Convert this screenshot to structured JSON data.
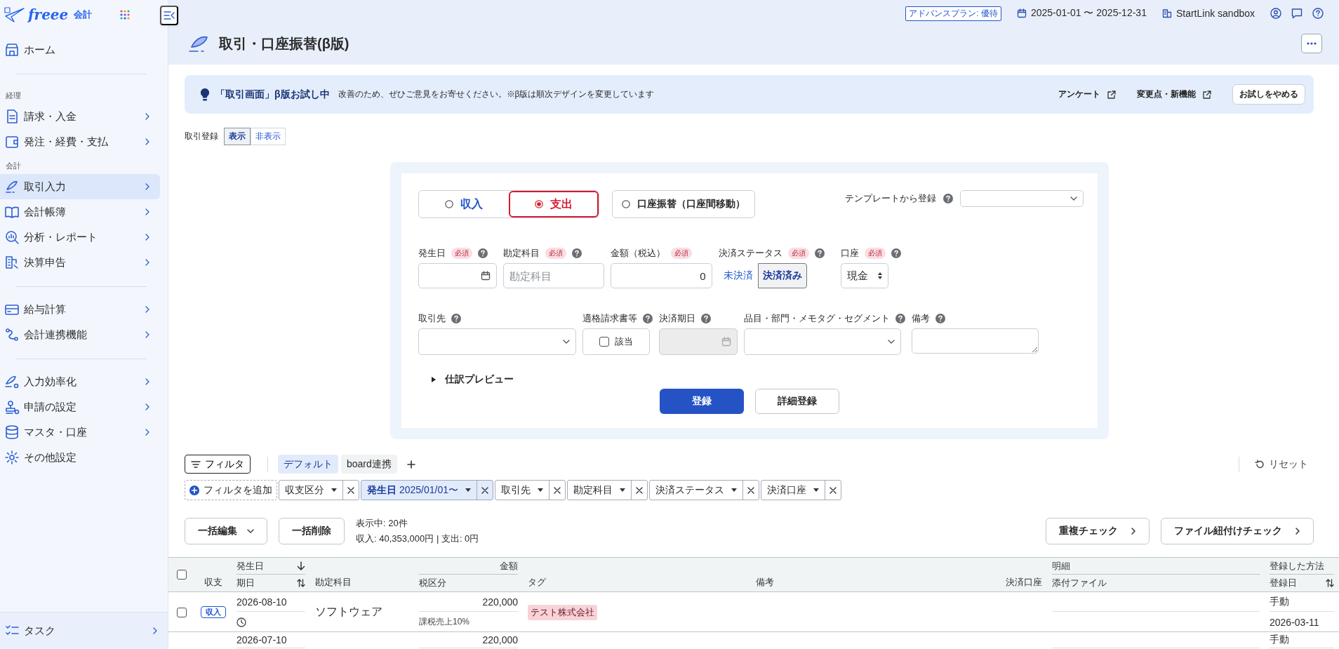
{
  "sidebar": {
    "logo": {
      "brand": "freee",
      "product": "会計"
    },
    "items": [
      {
        "kind": "item",
        "label": "ホーム",
        "selected": false,
        "has_submenu": false
      },
      {
        "kind": "divider"
      },
      {
        "kind": "section",
        "label": "経理"
      },
      {
        "kind": "item",
        "label": "請求・入金",
        "selected": false,
        "has_submenu": true
      },
      {
        "kind": "item",
        "label": "発注・経費・支払",
        "selected": false,
        "has_submenu": true
      },
      {
        "kind": "section",
        "label": "会計"
      },
      {
        "kind": "item",
        "label": "取引入力",
        "selected": true,
        "has_submenu": true
      },
      {
        "kind": "item",
        "label": "会計帳簿",
        "selected": false,
        "has_submenu": true
      },
      {
        "kind": "item",
        "label": "分析・レポート",
        "selected": false,
        "has_submenu": true
      },
      {
        "kind": "item",
        "label": "決算申告",
        "selected": false,
        "has_submenu": true
      },
      {
        "kind": "divider"
      },
      {
        "kind": "item",
        "label": "給与計算",
        "selected": false,
        "has_submenu": true
      },
      {
        "kind": "item",
        "label": "会計連携機能",
        "selected": false,
        "has_submenu": true
      },
      {
        "kind": "divider"
      },
      {
        "kind": "item",
        "label": "入力効率化",
        "selected": false,
        "has_submenu": true
      },
      {
        "kind": "item",
        "label": "申請の設定",
        "selected": false,
        "has_submenu": true
      },
      {
        "kind": "item",
        "label": "マスタ・口座",
        "selected": false,
        "has_submenu": true
      },
      {
        "kind": "item",
        "label": "その他設定",
        "selected": false,
        "has_submenu": false
      }
    ],
    "footer": {
      "label": "タスク",
      "has_submenu": true
    }
  },
  "top_bar": {
    "plan_badge": "アドバンスプラン: 優待",
    "period": "2025-01-01 〜 2025-12-31",
    "company": "StartLink sandbox"
  },
  "page_title": "取引・口座振替(β版)",
  "banner": {
    "title": "「取引画面」β版お試し中",
    "message": "改善のため、ぜひご意見をお寄せください。※β版は順次デザインを変更しています",
    "links": [
      "アンケート",
      "変更点・新機能"
    ],
    "button": "お試しをやめる"
  },
  "entry_toggle": {
    "label": "取引登録",
    "options": [
      {
        "label": "表示",
        "selected": true
      },
      {
        "label": "非表示",
        "selected": false
      }
    ]
  },
  "form": {
    "types": [
      {
        "kind": "income",
        "label": "収入",
        "selected": false
      },
      {
        "kind": "expense",
        "label": "支出",
        "selected": true
      },
      {
        "kind": "transfer",
        "label": "口座振替（口座間移動）",
        "selected": false
      }
    ],
    "template": {
      "label": "テンプレートから登録",
      "help": true
    },
    "field_rows": [
      [
        {
          "kind": "date",
          "label": "発生日",
          "required_badge": "必須",
          "help": true,
          "disabled": false
        },
        {
          "kind": "text",
          "label": "勘定科目",
          "required_badge": "必須",
          "help": true,
          "placeholder": "勘定科目",
          "disabled": false
        },
        {
          "kind": "amount",
          "label": "金額（税込）",
          "required_badge": "必須",
          "help": false,
          "value": "0",
          "disabled": false
        },
        {
          "kind": "segmented",
          "label": "決済ステータス",
          "required_badge": "必須",
          "help": true,
          "disabled": false,
          "options": [
            {
              "label": "未決済",
              "selected": false
            },
            {
              "label": "決済済み",
              "selected": true
            }
          ]
        },
        {
          "kind": "native_select",
          "label": "口座",
          "required_badge": "必須",
          "help": true,
          "value": "現金",
          "disabled": false
        }
      ],
      [
        {
          "kind": "select",
          "label": "取引先",
          "help": true,
          "disabled": false
        },
        {
          "kind": "checkbox",
          "label": "適格請求書等",
          "help": true,
          "checkbox_label": "該当",
          "checked": false,
          "disabled": false
        },
        {
          "kind": "date",
          "label": "決済期日",
          "help": true,
          "disabled": true
        },
        {
          "kind": "select",
          "label": "品目・部門・メモタグ・セグメント",
          "help": true,
          "disabled": false
        },
        {
          "kind": "textarea",
          "label": "備考",
          "help": true,
          "disabled": false
        }
      ]
    ],
    "preview": {
      "label": "仕訳プレビュー",
      "expanded": false
    },
    "buttons": [
      {
        "kind": "primary",
        "label": "登録"
      },
      {
        "kind": "secondary",
        "label": "詳細登録"
      }
    ]
  },
  "filters": {
    "filter_button": "フィルタ",
    "presets": [
      {
        "label": "デフォルト",
        "selected": true
      },
      {
        "label": "board連携",
        "selected": false
      }
    ],
    "reset": "リセット",
    "add_filter": "フィルタを追加",
    "chips": [
      {
        "label": "収支区分",
        "active": false
      },
      {
        "label": "**発生日** 2025/01/01〜",
        "active": true
      },
      {
        "label": "取引先",
        "active": false
      },
      {
        "label": "勘定科目",
        "active": false
      },
      {
        "label": "決済ステータス",
        "active": false
      },
      {
        "label": "決済口座",
        "active": false
      }
    ]
  },
  "bulk_actions": {
    "buttons": [
      {
        "label": "一括編集",
        "has_menu": true
      },
      {
        "label": "一括削除",
        "has_menu": false
      }
    ],
    "summary": [
      "表示中: 20件",
      "収入: 40,353,000円 | 支出: 0円"
    ],
    "checks": [
      "重複チェック",
      "ファイル紐付けチェック"
    ]
  },
  "table": {
    "select_all": {
      "checked": false
    },
    "columns": [
      {
        "label": "収支"
      },
      {
        "label": "発生日",
        "sorted": true,
        "sub_label": "期日",
        "sub_sortable": true
      },
      {
        "label": "勘定科目"
      },
      {
        "label": "金額",
        "sub_label": "税区分"
      },
      {
        "label": "タグ"
      },
      {
        "label": "備考"
      },
      {
        "label": "決済口座"
      },
      {
        "label": "明細",
        "sub_label": "添付ファイル"
      },
      {
        "label": "登録した方法",
        "sorted": false,
        "sub_label": "登録日",
        "sub_sortable": true
      }
    ],
    "rows": [
      {
        "checked": false,
        "type": "収入",
        "date": "2026-08-10",
        "due_pending": true,
        "account": "ソフトウェア",
        "amount": "220,000",
        "tax": "課税売上10%",
        "tag": "テスト株式会社",
        "method": "手動",
        "registered": "2026-03-11"
      },
      {
        "date": "2026-07-10",
        "amount": "220,000",
        "method": "手動"
      }
    ]
  }
}
